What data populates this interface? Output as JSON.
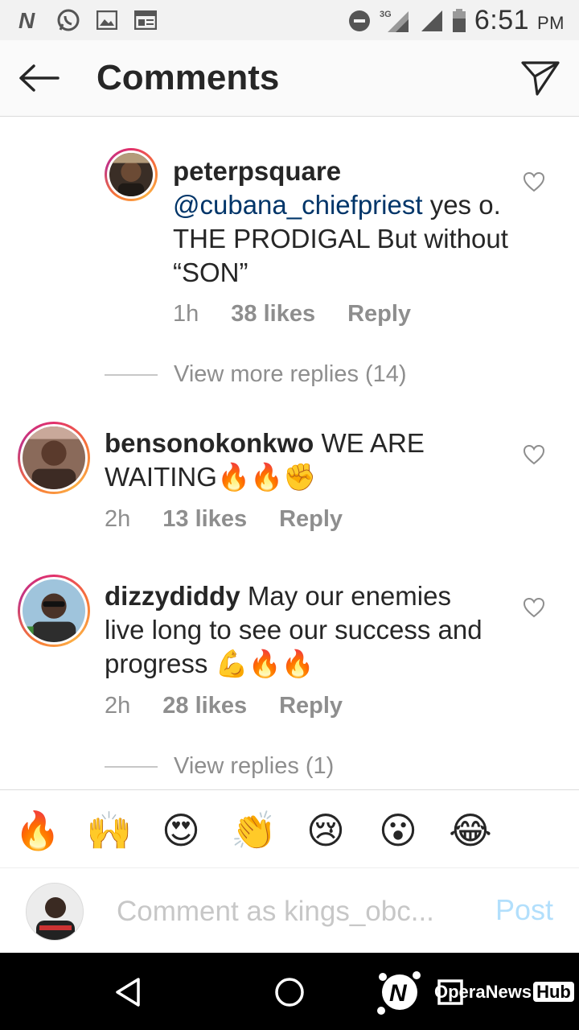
{
  "status_bar": {
    "time": "6:51",
    "ampm": "PM",
    "network": "3G"
  },
  "header": {
    "title": "Comments"
  },
  "comments": [
    {
      "username": "peterpsquare",
      "mention": "@cubana_chiefpriest",
      "text": " yes o. THE PRODIGAL But without “SON”",
      "time": "1h",
      "likes": "38 likes",
      "reply": "Reply"
    },
    {
      "username": "bensonokonkwo",
      "text": " WE ARE WAITING",
      "emoji": "🔥🔥✊",
      "time": "2h",
      "likes": "13 likes",
      "reply": "Reply"
    },
    {
      "username": "dizzydiddy",
      "text": " May our enemies live long to see our  success and progress ",
      "emoji": "💪🔥🔥",
      "time": "2h",
      "likes": "28 likes",
      "reply": "Reply"
    }
  ],
  "view_more_replies": "View more replies (14)",
  "view_replies": "View replies (1)",
  "emoji_bar": [
    "🔥",
    "🙌",
    "😍",
    "👏",
    "😢",
    "😮",
    "😂"
  ],
  "composer": {
    "placeholder": "Comment as kings_obc...",
    "post_label": "Post"
  },
  "watermark": {
    "brand": "OperaNews",
    "hub": "Hub"
  },
  "colors": {
    "mention": "#003569",
    "meta": "#8e8e8e",
    "post_disabled": "#b2dffc"
  }
}
